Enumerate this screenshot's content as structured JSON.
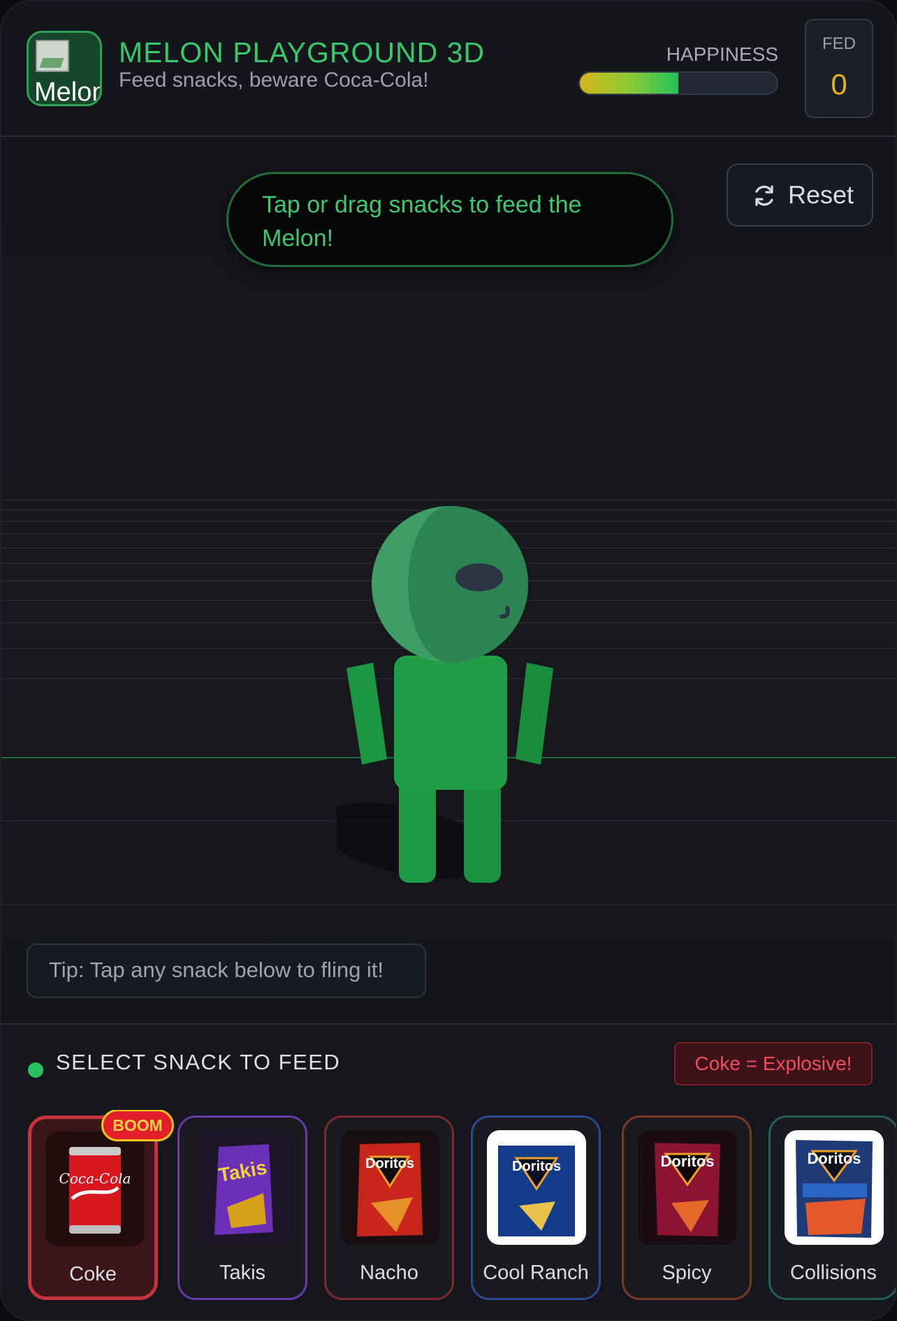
{
  "header": {
    "icon_alt": "Melon",
    "title": "MELON PLAYGROUND 3D",
    "subtitle": "Feed snacks, beware Coca-Cola!",
    "happiness_label": "HAPPINESS",
    "happiness_fraction": 0.5,
    "fed_label": "FED",
    "fed_value": "0"
  },
  "scene": {
    "banner_text": "Tap or drag snacks to feed the Melon!",
    "reset_label": "Reset",
    "tip_text": "Tip: Tap any snack below to fling it!"
  },
  "tray": {
    "title": "SELECT SNACK TO FEED",
    "warning": "Coke = Explosive!",
    "snacks": [
      {
        "name": "Coke",
        "badge": "BOOM",
        "border": "#c8323b",
        "selected": true
      },
      {
        "name": "Takis",
        "border": "#6a3aa8"
      },
      {
        "name": "Nacho",
        "border": "#7d2a2e"
      },
      {
        "name": "Cool Ranch",
        "border": "#2a4b94"
      },
      {
        "name": "Spicy",
        "border": "#7a3a22"
      },
      {
        "name": "Collisions",
        "border": "#1f6358"
      }
    ],
    "package_text": {
      "coke": "Coca-Cola",
      "takis": "Takis",
      "doritos": "Doritos"
    }
  },
  "colors": {
    "accent_green": "#38c86b",
    "fed_yellow": "#e3b21d",
    "danger_red": "#ef4f5d"
  }
}
